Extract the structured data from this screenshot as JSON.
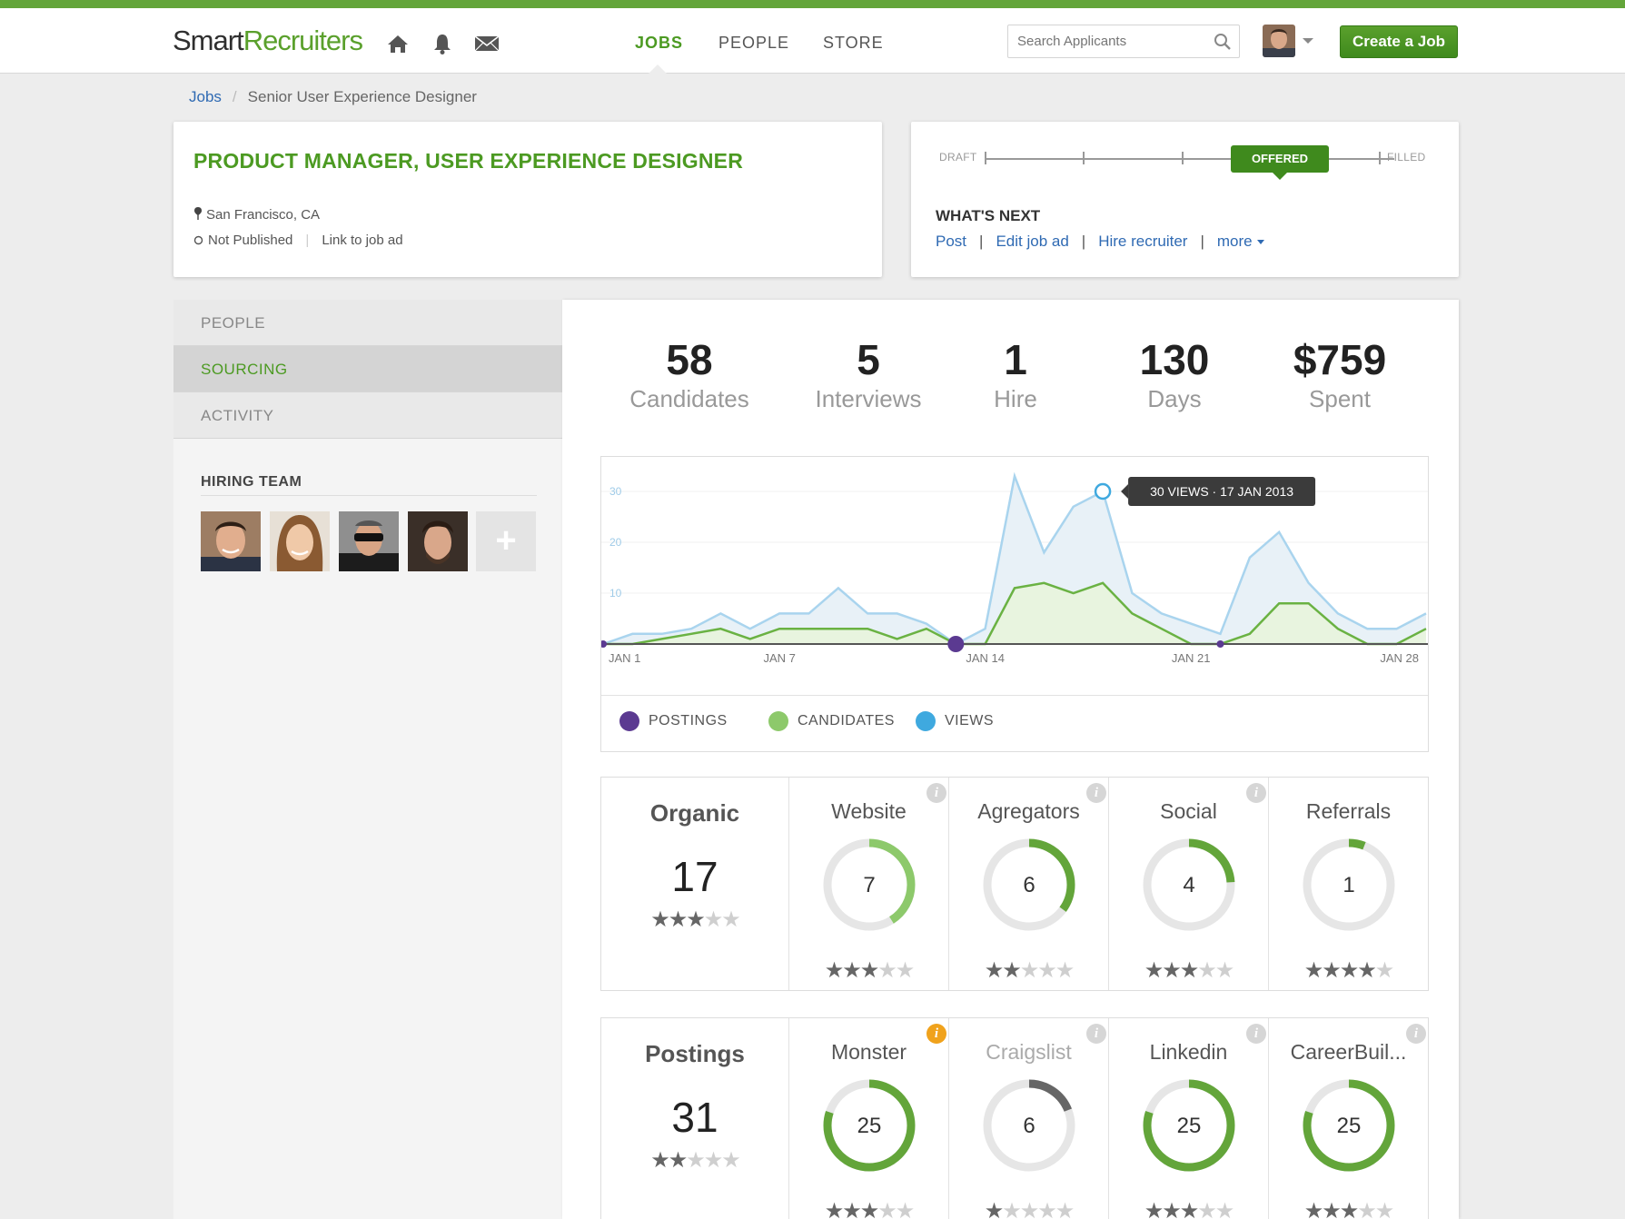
{
  "app": {
    "logo_dark": "Smart",
    "logo_green": "Recruiters",
    "colors": {
      "accent": "#4c9a22",
      "link": "#2f6ab3",
      "postings": "#5b3a91",
      "candidates": "#8dc96b",
      "views": "#3fa9df"
    }
  },
  "header": {
    "icons": [
      "home-icon",
      "bell-icon",
      "mail-icon"
    ],
    "nav": [
      {
        "label": "JOBS",
        "active": true
      },
      {
        "label": "PEOPLE",
        "active": false
      },
      {
        "label": "STORE",
        "active": false
      }
    ],
    "search_placeholder": "Search Applicants",
    "create_button": "Create a Job"
  },
  "breadcrumb": {
    "root": "Jobs",
    "separator": "/",
    "current": "Senior User Experience Designer"
  },
  "job": {
    "title": "PRODUCT MANAGER, USER EXPERIENCE DESIGNER",
    "location": "San Francisco, CA",
    "status": "Not Published",
    "link_label": "Link to job ad"
  },
  "workflow": {
    "start_label": "DRAFT",
    "current_stage": "OFFERED",
    "end_label": "FILLED",
    "whats_next_title": "WHAT'S NEXT",
    "actions": [
      "Post",
      "Edit job ad",
      "Hire recruiter",
      "more"
    ]
  },
  "sidebar": {
    "items": [
      {
        "label": "PEOPLE",
        "active": false
      },
      {
        "label": "SOURCING",
        "active": true
      },
      {
        "label": "ACTIVITY",
        "active": false
      }
    ],
    "hiring_team_title": "HIRING TEAM",
    "add_label": "+"
  },
  "stats": [
    {
      "value": "58",
      "label": "Candidates"
    },
    {
      "value": "5",
      "label": "Interviews"
    },
    {
      "value": "1",
      "label": "Hire"
    },
    {
      "value": "130",
      "label": "Days"
    },
    {
      "value": "$759",
      "label": "Spent"
    }
  ],
  "chart_data": {
    "type": "area",
    "x_ticks": [
      "JAN 1",
      "JAN 7",
      "JAN 14",
      "JAN 21",
      "JAN 28"
    ],
    "y_ticks": [
      "10",
      "20",
      "30"
    ],
    "ylim": [
      0,
      35
    ],
    "x": [
      1,
      2,
      3,
      4,
      5,
      6,
      7,
      8,
      9,
      10,
      11,
      12,
      13,
      14,
      15,
      16,
      17,
      18,
      19,
      20,
      21,
      22,
      23,
      24,
      25,
      26,
      27,
      28,
      29
    ],
    "series": [
      {
        "name": "VIEWS",
        "values": [
          0,
          2,
          2,
          3,
          6,
          3,
          6,
          6,
          11,
          6,
          6,
          4,
          0,
          3,
          33,
          18,
          27,
          30,
          10,
          6,
          4,
          2,
          17,
          22,
          12,
          6,
          3,
          3,
          6
        ]
      },
      {
        "name": "CANDIDATES",
        "values": [
          0,
          0,
          1,
          2,
          3,
          1,
          3,
          3,
          3,
          3,
          1,
          3,
          0,
          0,
          11,
          12,
          10,
          12,
          6,
          3,
          0,
          0,
          2,
          8,
          8,
          3,
          0,
          0,
          3
        ]
      },
      {
        "name": "POSTINGS",
        "values": [
          0,
          0,
          0,
          0,
          0,
          0,
          0,
          0,
          0,
          0,
          0,
          0,
          0,
          0,
          0,
          0,
          0,
          0,
          0,
          0,
          0,
          0,
          0,
          0,
          0,
          0,
          0,
          0,
          0
        ]
      }
    ],
    "posting_markers": [
      1,
      13,
      22
    ],
    "tooltip": "30 VIEWS  ·  17 JAN 2013",
    "tooltip_index": 17,
    "legend": [
      "POSTINGS",
      "CANDIDATES",
      "VIEWS"
    ]
  },
  "organic": {
    "title": "Organic",
    "total": "17",
    "rating": 3,
    "sources": [
      {
        "name": "Website",
        "value": "7",
        "fraction": 0.41,
        "rating": 3,
        "dim": false,
        "info": "normal",
        "color": "#8dc96b"
      },
      {
        "name": "Agregators",
        "value": "6",
        "fraction": 0.35,
        "rating": 2,
        "dim": false,
        "info": "normal",
        "color": "#63a53a"
      },
      {
        "name": "Social",
        "value": "4",
        "fraction": 0.24,
        "rating": 3,
        "dim": false,
        "info": "normal",
        "color": "#63a53a"
      },
      {
        "name": "Referrals",
        "value": "1",
        "fraction": 0.06,
        "rating": 4,
        "dim": false,
        "info": "none",
        "color": "#63a53a"
      }
    ]
  },
  "postings": {
    "title": "Postings",
    "total": "31",
    "rating": 2,
    "sources": [
      {
        "name": "Monster",
        "value": "25",
        "fraction": 0.8,
        "rating": 3,
        "dim": false,
        "info": "warn",
        "color": "#63a53a"
      },
      {
        "name": "Craigslist",
        "value": "6",
        "fraction": 0.19,
        "rating": 1,
        "dim": true,
        "info": "normal",
        "color": "#666666"
      },
      {
        "name": "Linkedin",
        "value": "25",
        "fraction": 0.8,
        "rating": 3,
        "dim": false,
        "info": "normal",
        "color": "#63a53a"
      },
      {
        "name": "CareerBuil...",
        "value": "25",
        "fraction": 0.8,
        "rating": 3,
        "dim": false,
        "info": "normal",
        "color": "#63a53a"
      }
    ]
  }
}
